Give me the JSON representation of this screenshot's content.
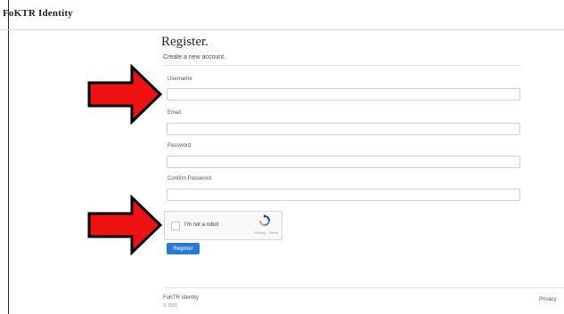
{
  "header": {
    "brand": "FoKTR Identity"
  },
  "page": {
    "title": "Register.",
    "subtitle": "Create a new account."
  },
  "form": {
    "fields": [
      {
        "label": "Username",
        "value": "",
        "placeholder": ""
      },
      {
        "label": "Email",
        "value": "",
        "placeholder": ""
      },
      {
        "label": "Password",
        "value": "",
        "placeholder": ""
      },
      {
        "label": "Confirm Password",
        "value": "",
        "placeholder": ""
      }
    ],
    "captcha": {
      "label": "I'm not a robot",
      "terms": "Privacy - Terms",
      "checked": false
    },
    "submit_label": "Register"
  },
  "footer": {
    "brand": "FoKTR Identity",
    "year": "© 2021",
    "link": "Privacy"
  },
  "annotations": {
    "arrow_color": "#ee1111"
  },
  "colors": {
    "accent": "#2a78d6"
  }
}
